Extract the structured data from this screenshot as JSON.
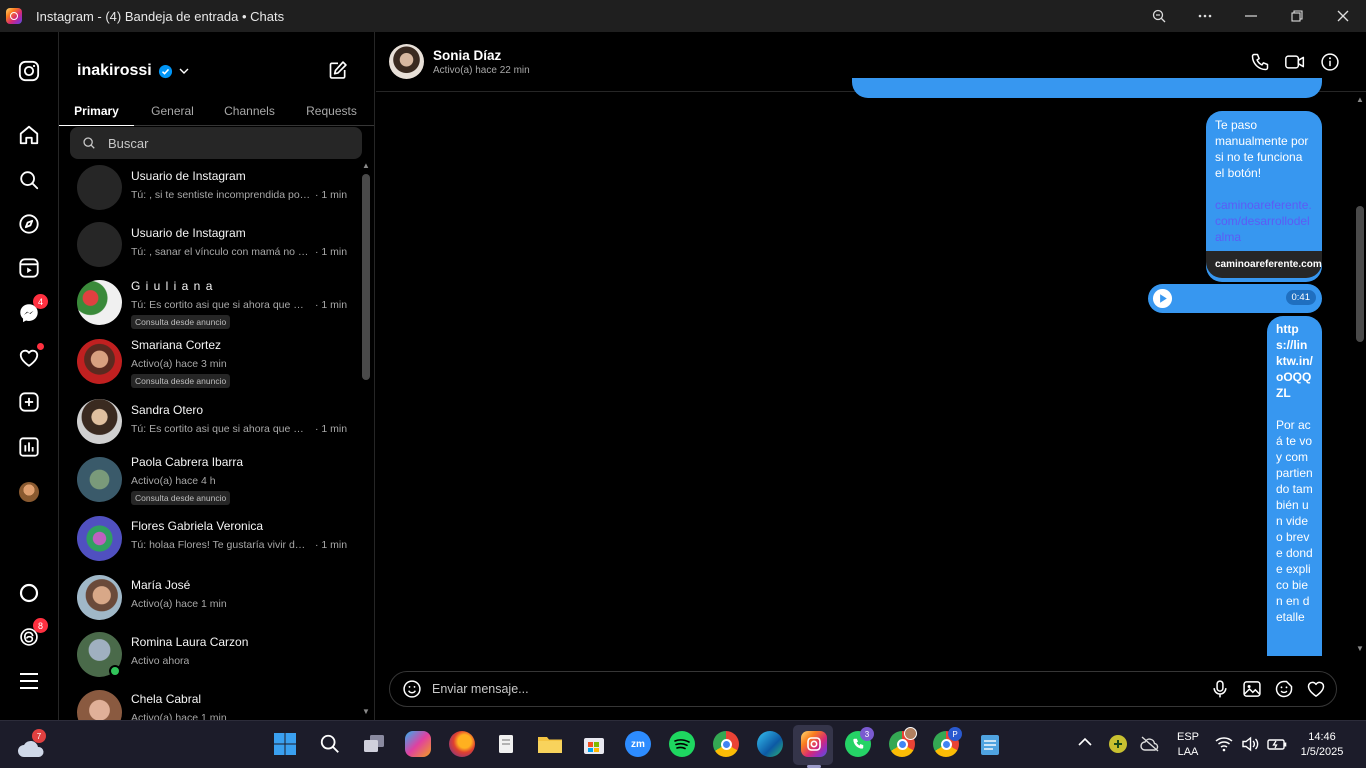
{
  "window": {
    "title": "Instagram - (4) Bandeja de entrada • Chats"
  },
  "rail": {
    "messenger_badge": "4",
    "threads_badge": "8"
  },
  "inbox": {
    "username": "inakirossi",
    "tabs": [
      "Primary",
      "General",
      "Channels",
      "Requests"
    ],
    "search_placeholder": "Buscar",
    "conversations": [
      {
        "name": "Usuario de Instagram",
        "preview": "Tú: , si te sentiste incomprendida por tu ...",
        "time": "· 1 min"
      },
      {
        "name": "Usuario de Instagram",
        "preview": "Tú: , sanar el vínculo con mamá no es hac...",
        "time": "· 1 min"
      },
      {
        "name": "G i u l i a n a",
        "preview": "Tú: Es cortito asi que si ahora que me lo ...",
        "time": "· 1 min",
        "tag": "Consulta desde anuncio"
      },
      {
        "name": "Smariana Cortez",
        "preview": "Activo(a) hace 3 min",
        "time": "",
        "tag": "Consulta desde anuncio"
      },
      {
        "name": "Sandra Otero",
        "preview": "Tú: Es cortito asi que si ahora que me lo ...",
        "time": "· 1 min"
      },
      {
        "name": "Paola Cabrera Ibarra",
        "preview": "Activo(a) hace 4 h",
        "time": "",
        "tag": "Consulta desde anuncio"
      },
      {
        "name": "Flores Gabriela Veronica",
        "preview": "Tú: holaa Flores! Te gustaría vivir de tu vo...",
        "time": "· 1 min"
      },
      {
        "name": "María José",
        "preview": "Activo(a) hace 1 min",
        "time": ""
      },
      {
        "name": "Romina Laura Carzon",
        "preview": "Activo ahora",
        "time": ""
      },
      {
        "name": "Chela Cabral",
        "preview": "Activo(a) hace 1 min",
        "time": ""
      }
    ]
  },
  "chat": {
    "contact_name": "Sonia Díaz",
    "contact_status": "Activo(a) hace 22 min",
    "messages": {
      "m1_text": "Te paso manualmente por si no te funciona el botón!",
      "m1_link": "caminoareferente.com/desarrollodelalma",
      "m1_domain": "caminoareferente.com",
      "audio_duration": "0:41",
      "m3_link": "https://linktw.in/oOQQZL",
      "m3_text": "Por acá te voy compartiendo también un video breve donde explico bien en detalle"
    },
    "composer_placeholder": "Enviar mensaje..."
  },
  "taskbar": {
    "weather_badge": "7",
    "whatsapp_badge": "3",
    "chrome_profile": "P",
    "lang_top": "ESP",
    "lang_bottom": "LAA",
    "time": "14:46",
    "date": "1/5/2025"
  },
  "colors": {
    "accent": "#3797f0",
    "badge": "#ff3040",
    "link": "#5c5cf5"
  }
}
